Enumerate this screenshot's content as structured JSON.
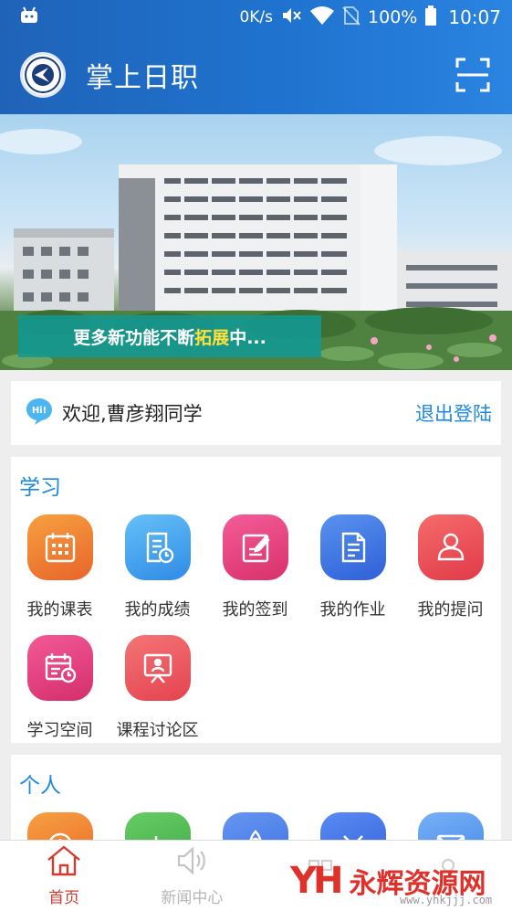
{
  "status_bar": {
    "network_speed": "0K/s",
    "battery_percent": "100%",
    "time": "10:07"
  },
  "app": {
    "title": "掌上日职"
  },
  "banner": {
    "caption_prefix": "更多新功能不断",
    "caption_highlight": "拓展",
    "caption_suffix": "中..."
  },
  "welcome": {
    "text": "欢迎,曹彦翔同学",
    "logout_label": "退出登陆"
  },
  "sections": {
    "study": {
      "title": "学习",
      "items": [
        {
          "label": "我的课表",
          "icon": "calendar-icon",
          "color_from": "#f7943a",
          "color_to": "#e8642a"
        },
        {
          "label": "我的成绩",
          "icon": "grade-report-icon",
          "color_from": "#5cb8f5",
          "color_to": "#2f8be6"
        },
        {
          "label": "我的签到",
          "icon": "sign-in-edit-icon",
          "color_from": "#f0508f",
          "color_to": "#d8306a"
        },
        {
          "label": "我的作业",
          "icon": "homework-document-icon",
          "color_from": "#4a86ec",
          "color_to": "#2f5fd8"
        },
        {
          "label": "我的提问",
          "icon": "question-person-icon",
          "color_from": "#f26161",
          "color_to": "#e03a48"
        },
        {
          "label": "学习空间",
          "icon": "study-space-calendar-icon",
          "color_from": "#ef4f8d",
          "color_to": "#d42e6c"
        },
        {
          "label": "课程讨论区",
          "icon": "discussion-board-icon",
          "color_from": "#f26a6a",
          "color_to": "#e44350"
        }
      ]
    },
    "personal": {
      "title": "个人",
      "items": [
        {
          "icon": "clock-icon",
          "color_from": "#f7943a",
          "color_to": "#e8642a"
        },
        {
          "icon": "chart-icon",
          "color_from": "#5fc760",
          "color_to": "#3ea843"
        },
        {
          "icon": "rocket-icon",
          "color_from": "#5b8cf0",
          "color_to": "#3a6ae0"
        },
        {
          "icon": "tools-icon",
          "color_from": "#4a7ef0",
          "color_to": "#2f5fd8"
        },
        {
          "icon": "mail-icon",
          "color_from": "#6aa6f5",
          "color_to": "#3f84ea"
        }
      ]
    }
  },
  "bottom_nav": {
    "items": [
      {
        "label": "首页",
        "active": true
      },
      {
        "label": "新闻中心",
        "active": false
      },
      {
        "label": "",
        "active": false
      },
      {
        "label": "",
        "active": false
      }
    ]
  },
  "watermark": {
    "mark": "YH",
    "text": "永辉资源网",
    "url": "www.yhkjjj.com"
  },
  "colors": {
    "accent": "#1e88e5",
    "header_blue": "#1f6fc6",
    "active_nav": "#d43b2f"
  }
}
